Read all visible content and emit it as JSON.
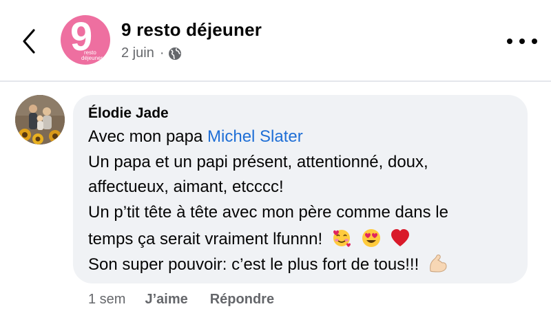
{
  "header": {
    "page_name": "9 resto déjeuner",
    "date": "2 juin",
    "separator": "·",
    "privacy_icon": "globe-icon",
    "back_icon": "chevron-left-icon",
    "more_icon": "more-horizontal-icon",
    "avatar_text_main": "9",
    "avatar_text_line1": "resto",
    "avatar_text_line2": "déjeuner",
    "avatar_color": "#ee6fa0"
  },
  "comment": {
    "author": "Élodie Jade",
    "line1_prefix": "Avec mon papa ",
    "mention": "Michel Slater",
    "line2": "Un papa et un papi présent, attentionné, doux,",
    "line3": "affectueux, aimant, etcccc!",
    "line4": "Un p’tit tête à tête avec mon père comme dans le",
    "line5": "temps ça serait vraiment lfunnn!",
    "line5_emojis": [
      "smiling-face-with-hearts-emoji",
      "heart-eyes-emoji",
      "red-heart-emoji"
    ],
    "line6": "Son super pouvoir: c’est le plus fort de tous!!!",
    "line6_emoji": "flexed-biceps-emoji",
    "bubble_color": "#f0f2f5",
    "mention_color": "#1f6fd6"
  },
  "actions": {
    "time": "1 sem",
    "like": "J’aime",
    "reply": "Répondre"
  }
}
